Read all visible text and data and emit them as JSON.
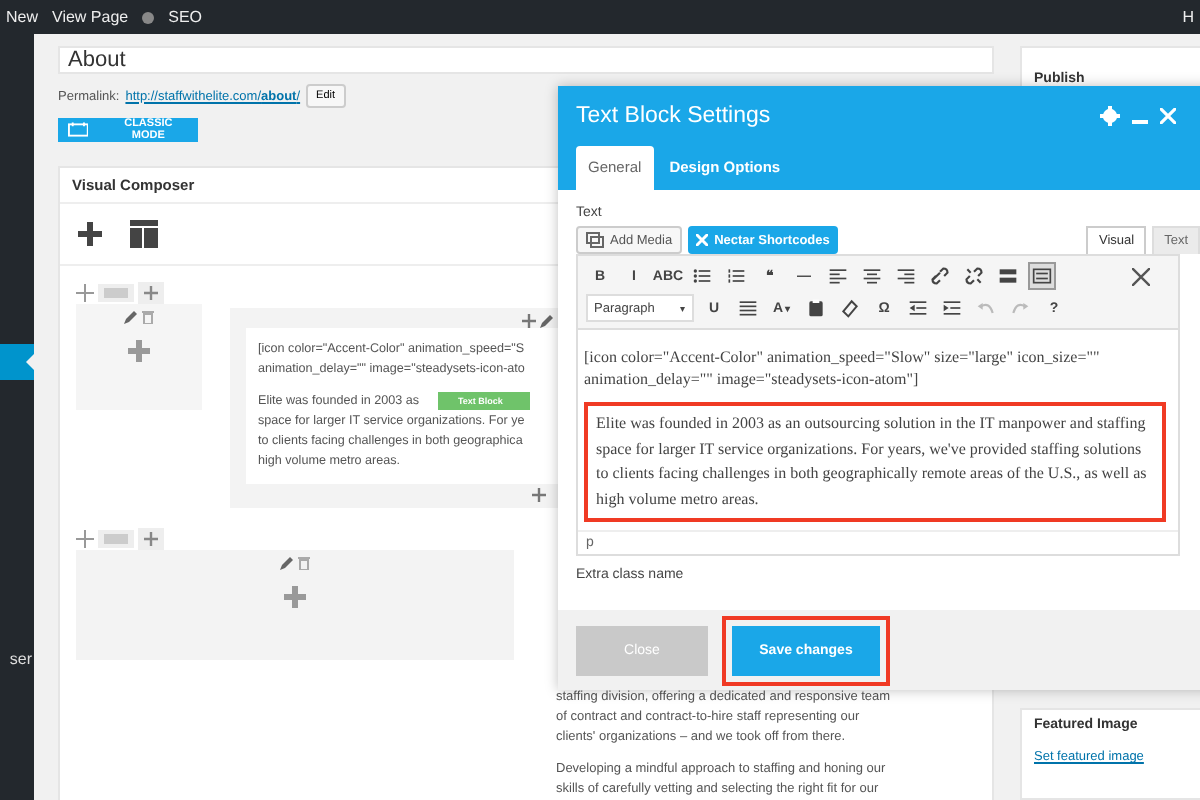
{
  "admin_bar": {
    "items": [
      "New",
      "View Page",
      "SEO"
    ],
    "right": "H"
  },
  "sidebar": {
    "active_label": "ser"
  },
  "page": {
    "title": "About",
    "permalink_label": "Permalink:",
    "permalink_base": "http://staffwithelite.com/",
    "permalink_slug": "about",
    "permalink_end": "/",
    "edit_button": "Edit",
    "classic_mode": "CLASSIC MODE"
  },
  "visual_composer": {
    "title": "Visual Composer",
    "text_block": {
      "shortcode_lines": [
        "[icon color=\"Accent-Color\" animation_speed=\"S",
        "animation_delay=\"\" image=\"steadysets-icon-ato"
      ],
      "body_lines": [
        "Elite was founded in 2003 as",
        "space for larger IT service organizations. For ye",
        "to clients facing challenges in both geographica",
        "high volume metro areas."
      ],
      "badge": "Text Block"
    },
    "page_text_lines": [
      "staffing division, offering a dedicated and responsive team",
      "of contract and contract-to-hire staff representing our",
      "clients' organizations – and we took off from there."
    ],
    "page_text_lines_2": [
      "Developing a mindful approach to staffing and honing our",
      "skills of carefully vetting and selecting the right fit for our"
    ]
  },
  "publish": {
    "title": "Publish"
  },
  "featured_image": {
    "title": "Featured Image",
    "link": "Set featured image"
  },
  "modal": {
    "title": "Text Block Settings",
    "tabs": [
      {
        "label": "General",
        "selected": true
      },
      {
        "label": "Design Options",
        "selected": false
      }
    ],
    "field_label": "Text",
    "add_media": "Add Media",
    "nectar": "Nectar Shortcodes",
    "editor_tabs": [
      {
        "label": "Visual",
        "selected": true
      },
      {
        "label": "Text",
        "selected": false
      }
    ],
    "toolbar_rows": [
      [
        {
          "kind": "bold",
          "text": "B",
          "selected": false,
          "disabled": false
        },
        {
          "kind": "italic",
          "text": "I",
          "selected": false,
          "disabled": false
        },
        {
          "kind": "strikethrough",
          "text": "ABC",
          "selected": false,
          "disabled": false
        },
        {
          "kind": "bullet-list",
          "selected": false,
          "disabled": false
        },
        {
          "kind": "number-list",
          "selected": false,
          "disabled": false
        },
        {
          "kind": "blockquote",
          "text": "❝",
          "selected": false,
          "disabled": false
        },
        {
          "kind": "horizontal-rule",
          "text": "—",
          "selected": false,
          "disabled": false
        },
        {
          "kind": "align-left",
          "selected": false,
          "disabled": false
        },
        {
          "kind": "align-center",
          "selected": false,
          "disabled": false
        },
        {
          "kind": "align-right",
          "selected": false,
          "disabled": false
        },
        {
          "kind": "link",
          "selected": false,
          "disabled": false
        },
        {
          "kind": "unlink",
          "selected": false,
          "disabled": false
        },
        {
          "kind": "read-more",
          "selected": false,
          "disabled": false
        },
        {
          "kind": "toolbar-toggle",
          "selected": true,
          "disabled": false
        }
      ],
      [
        {
          "kind": "format-select",
          "text": "Paragraph",
          "caret": "▾",
          "selected": false,
          "disabled": false
        },
        {
          "kind": "underline",
          "text": "U",
          "selected": false,
          "disabled": false
        },
        {
          "kind": "justify",
          "selected": false,
          "disabled": false
        },
        {
          "kind": "text-color",
          "text": "A",
          "caret": "▾",
          "selected": false,
          "disabled": false
        },
        {
          "kind": "paste",
          "selected": false,
          "disabled": false
        },
        {
          "kind": "eraser",
          "selected": false,
          "disabled": false
        },
        {
          "kind": "special-character",
          "text": "Ω",
          "selected": false,
          "disabled": false
        },
        {
          "kind": "outdent",
          "selected": false,
          "disabled": false
        },
        {
          "kind": "indent",
          "selected": false,
          "disabled": false
        },
        {
          "kind": "undo",
          "selected": false,
          "disabled": true
        },
        {
          "kind": "redo",
          "selected": false,
          "disabled": true
        },
        {
          "kind": "help",
          "text": "?",
          "selected": false,
          "disabled": false
        }
      ]
    ],
    "shortcode_lines": [
      "[icon color=\"Accent-Color\" animation_speed=\"Slow\" size=\"large\" icon_size=\"\"",
      "animation_delay=\"\" image=\"steadysets-icon-atom\"]"
    ],
    "paragraph": {
      "text": "Elite was founded in 2003 as an outsourcing solution in the IT manpower and staffing space for larger IT service organizations. For years, we've provided staffing solutions to clients facing challenges in both geographically remote areas of the U.S., as well as high volume metro areas.",
      "highlighted": true
    },
    "path": "p",
    "extra_class_label": "Extra class name",
    "close": {
      "label": "Close",
      "highlighted": false
    },
    "save": {
      "label": "Save changes",
      "highlighted": true
    }
  }
}
